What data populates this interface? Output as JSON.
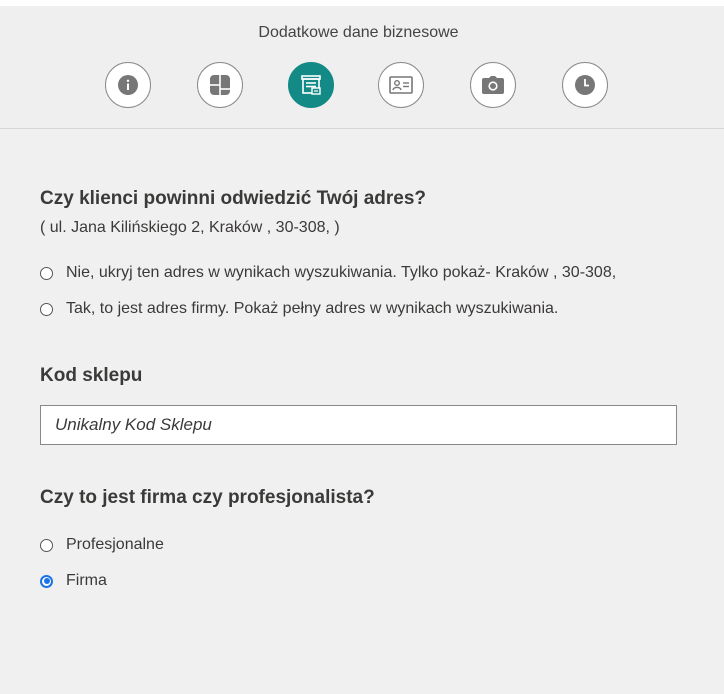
{
  "header": {
    "title": "Dodatkowe dane biznesowe",
    "steps": [
      {
        "icon": "info-icon",
        "active": false
      },
      {
        "icon": "categories-icon",
        "active": false
      },
      {
        "icon": "store-icon",
        "active": true
      },
      {
        "icon": "contact-card-icon",
        "active": false
      },
      {
        "icon": "camera-icon",
        "active": false
      },
      {
        "icon": "clock-icon",
        "active": false
      }
    ],
    "accent_color": "#148a86"
  },
  "address_section": {
    "question": "Czy klienci powinni odwiedzić Twój adres?",
    "address": "( ul. Jana Kilińskiego 2, Kraków , 30-308, )",
    "options": [
      {
        "label": "Nie, ukryj ten adres w wynikach wyszukiwania. Tylko pokaż- Kraków , 30-308,",
        "checked": false
      },
      {
        "label": "Tak, to jest adres firmy. Pokaż pełny adres w wynikach wyszukiwania.",
        "checked": false
      }
    ]
  },
  "store_code_section": {
    "title": "Kod sklepu",
    "placeholder": "Unikalny Kod Sklepu",
    "value": ""
  },
  "business_type_section": {
    "question": "Czy to jest firma czy profesjonalista?",
    "options": [
      {
        "label": "Profesjonalne",
        "checked": false
      },
      {
        "label": "Firma",
        "checked": true
      }
    ],
    "radio_color": "#1a73e8"
  }
}
